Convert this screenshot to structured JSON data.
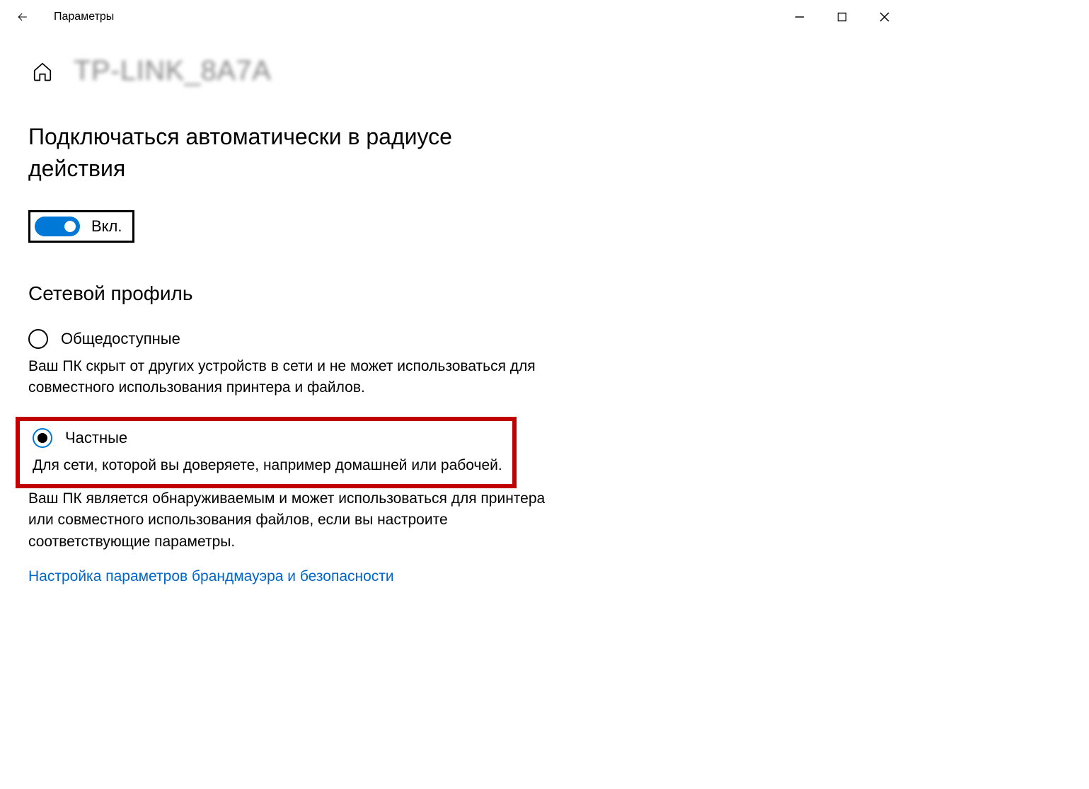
{
  "titlebar": {
    "app_title": "Параметры"
  },
  "header": {
    "network_name": "TP-LINK_8A7A"
  },
  "auto_connect": {
    "heading": "Подключаться автоматически в радиусе действия",
    "toggle_state": "on",
    "toggle_label": "Вкл."
  },
  "network_profile": {
    "heading": "Сетевой профиль",
    "options": [
      {
        "label": "Общедоступные",
        "desc": "Ваш ПК скрыт от других устройств в сети и не может использоваться для совместного использования принтера и файлов.",
        "selected": false
      },
      {
        "label": "Частные",
        "desc_line1": "Для сети, которой вы доверяете, например домашней или рабочей.",
        "desc_rest": "Ваш ПК является обнаруживаемым и может использоваться для принтера или совместного использования файлов, если вы настроите соответствующие параметры.",
        "selected": true
      }
    ],
    "firewall_link": "Настройка параметров брандмауэра и безопасности"
  }
}
